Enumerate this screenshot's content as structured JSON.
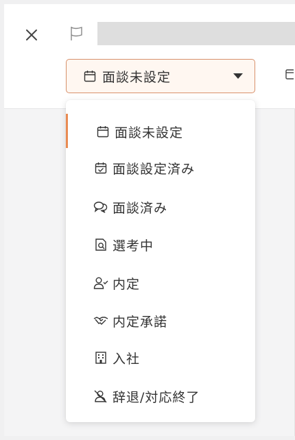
{
  "status": {
    "selected_label": "面談未設定",
    "accent_color": "#d7906a"
  },
  "menu": {
    "items": [
      {
        "label": "面談未設定",
        "icon": "calendar-icon",
        "selected": true
      },
      {
        "label": "面談設定済み",
        "icon": "calendar-check-icon"
      },
      {
        "label": "面談済み",
        "icon": "chat-bubbles-icon"
      },
      {
        "label": "選考中",
        "icon": "document-search-icon"
      },
      {
        "label": "内定",
        "icon": "user-check-icon"
      },
      {
        "label": "内定承諾",
        "icon": "handshake-icon"
      },
      {
        "label": "入社",
        "icon": "building-icon"
      },
      {
        "label": "辞退/対応終了",
        "icon": "user-off-icon"
      }
    ]
  },
  "icons": {
    "close": "close-icon",
    "flag": "flag-icon"
  }
}
